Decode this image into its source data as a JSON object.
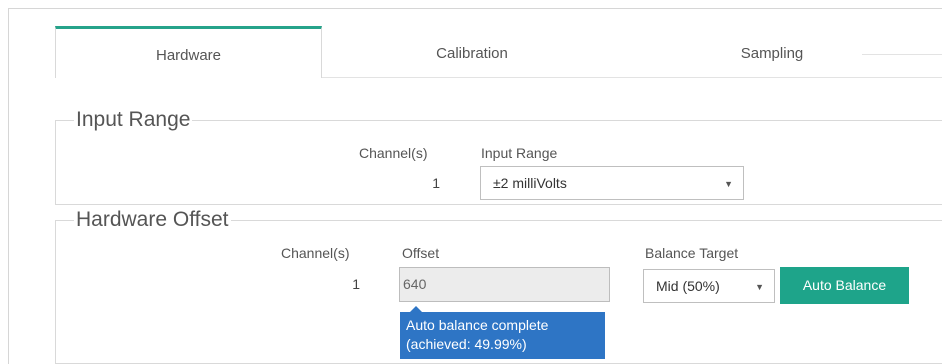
{
  "tabs": [
    {
      "label": "Hardware",
      "active": true
    },
    {
      "label": "Calibration",
      "active": false
    },
    {
      "label": "Sampling",
      "active": false
    }
  ],
  "input_range": {
    "title": "Input Range",
    "channel_header": "Channel(s)",
    "range_header": "Input Range",
    "channel": "1",
    "range_value": "±2 milliVolts"
  },
  "hardware_offset": {
    "title": "Hardware Offset",
    "channel_header": "Channel(s)",
    "offset_header": "Offset",
    "balance_header": "Balance Target",
    "channel": "1",
    "offset_value": "640",
    "balance_value": "Mid (50%)",
    "auto_balance_label": "Auto Balance",
    "status_line1": "Auto balance complete",
    "status_line2": "(achieved: 49.99%)"
  },
  "colors": {
    "accent": "#1ea48a",
    "tooltip": "#2e75c5"
  },
  "icons": {
    "dropdown": "chevron-down-icon"
  }
}
